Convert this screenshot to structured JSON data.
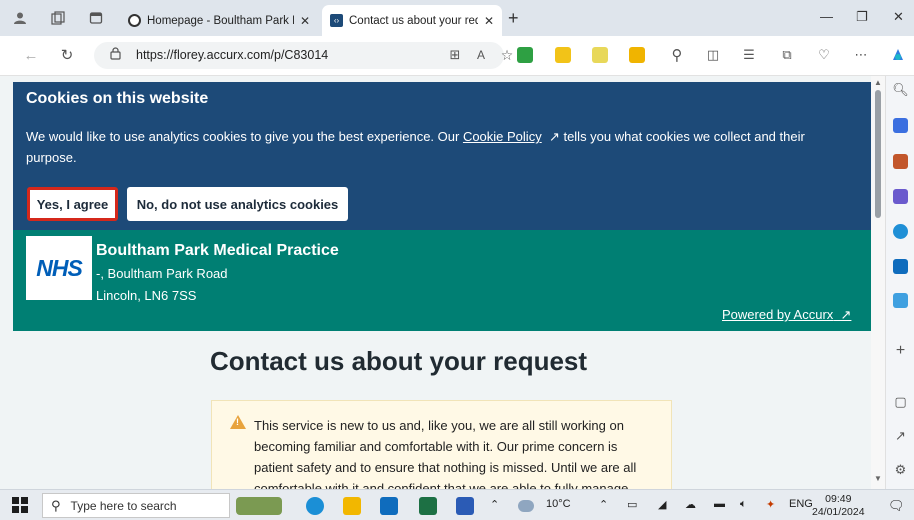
{
  "browser": {
    "tabs": [
      {
        "title": "Homepage - Boultham Park Med",
        "active": false
      },
      {
        "title": "Contact us about your request",
        "active": true
      }
    ],
    "url": "https://florey.accurx.com/p/C83014",
    "accent": "#0078d4"
  },
  "cookie_banner": {
    "heading": "Cookies on this website",
    "message_before_link": "We would like to use analytics cookies to give you the best experience. Our ",
    "link_text": "Cookie Policy",
    "message_after_link": " tells you what cookies we collect and their purpose.",
    "agree_label": "Yes, I agree",
    "decline_label": "No, do not use analytics cookies",
    "bg_color": "#1d4a78"
  },
  "header": {
    "logo_text": "NHS",
    "practice_name": "Boultham Park Medical Practice",
    "address_line1": "-, Boultham Park Road",
    "address_line2": "Lincoln, LN6 7SS",
    "powered_by": "Powered by Accurx",
    "bg_color": "#007f73"
  },
  "main": {
    "title": "Contact us about your request",
    "notice": "This service is new to us and, like you, we are all still working on becoming familiar and comfortable with it. Our prime concern is patient safety and to ensure that nothing is missed. Until we are all comfortable with it and confident that we are able to fully manage"
  },
  "taskbar": {
    "search_placeholder": "Type here to search",
    "weather": "10°C",
    "language": "ENG",
    "time": "09:49",
    "date": "24/01/2024"
  }
}
